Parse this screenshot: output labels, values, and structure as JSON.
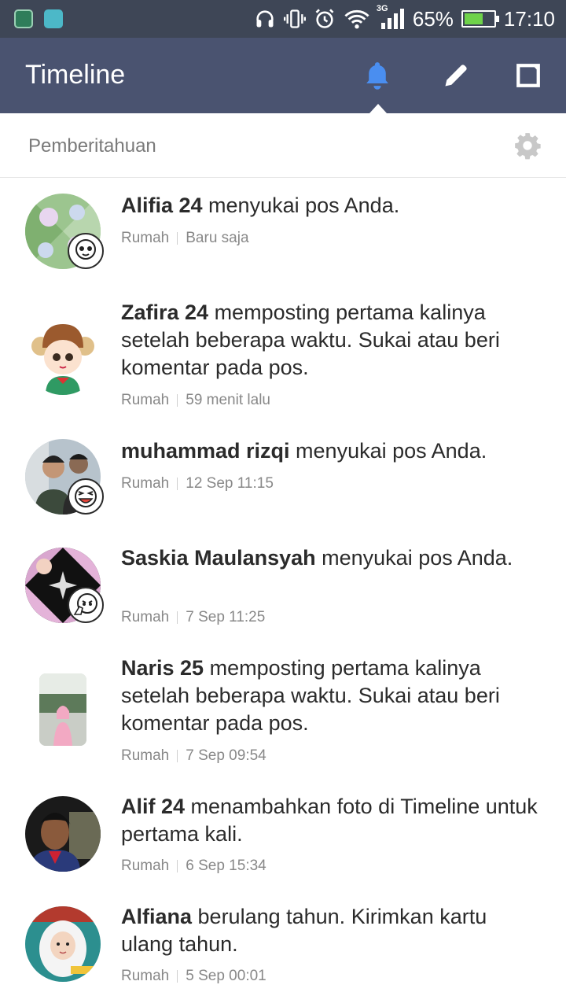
{
  "status_bar": {
    "network_type": "3G",
    "battery_percent": "65%",
    "time": "17:10",
    "icons": [
      "app-icon",
      "android-icon",
      "headphones-icon",
      "vibrate-icon",
      "alarm-icon",
      "wifi-icon",
      "signal-icon",
      "battery-charging-icon"
    ],
    "battery_level": 0.65
  },
  "header": {
    "title": "Timeline",
    "icons": [
      "bell-icon",
      "pencil-icon",
      "square-icon"
    ],
    "active_color": "#4a8ef0",
    "background": "#4a5370"
  },
  "section": {
    "title": "Pemberitahuan",
    "icon": "gear-icon"
  },
  "notifications": [
    {
      "name": "Alifia 24",
      "message": " menyukai pos Anda.",
      "source": "Rumah",
      "time": "Baru saja"
    },
    {
      "name": "Zafira 24",
      "message": " memposting pertama kalinya setelah beberapa waktu. Sukai atau beri komentar pada pos.",
      "source": "Rumah",
      "time": "59 menit lalu"
    },
    {
      "name": "muhammad rizqi",
      "message": " menyukai pos Anda.",
      "source": "Rumah",
      "time": "12 Sep 11:15"
    },
    {
      "name": "Saskia Maulansyah",
      "message": " menyukai pos Anda.",
      "source": "Rumah",
      "time": "7 Sep 11:25"
    },
    {
      "name": "Naris 25",
      "message": " memposting pertama kalinya setelah beberapa waktu. Sukai atau beri komentar pada pos.",
      "source": "Rumah",
      "time": "7 Sep 09:54"
    },
    {
      "name": "Alif 24",
      "message": " menambahkan foto di Timeline untuk pertama kali.",
      "source": "Rumah",
      "time": "6 Sep 15:34"
    },
    {
      "name": "Alfiana",
      "message": " berulang tahun. Kirimkan kartu ulang tahun.",
      "source": "Rumah",
      "time": "5 Sep 00:01"
    }
  ]
}
